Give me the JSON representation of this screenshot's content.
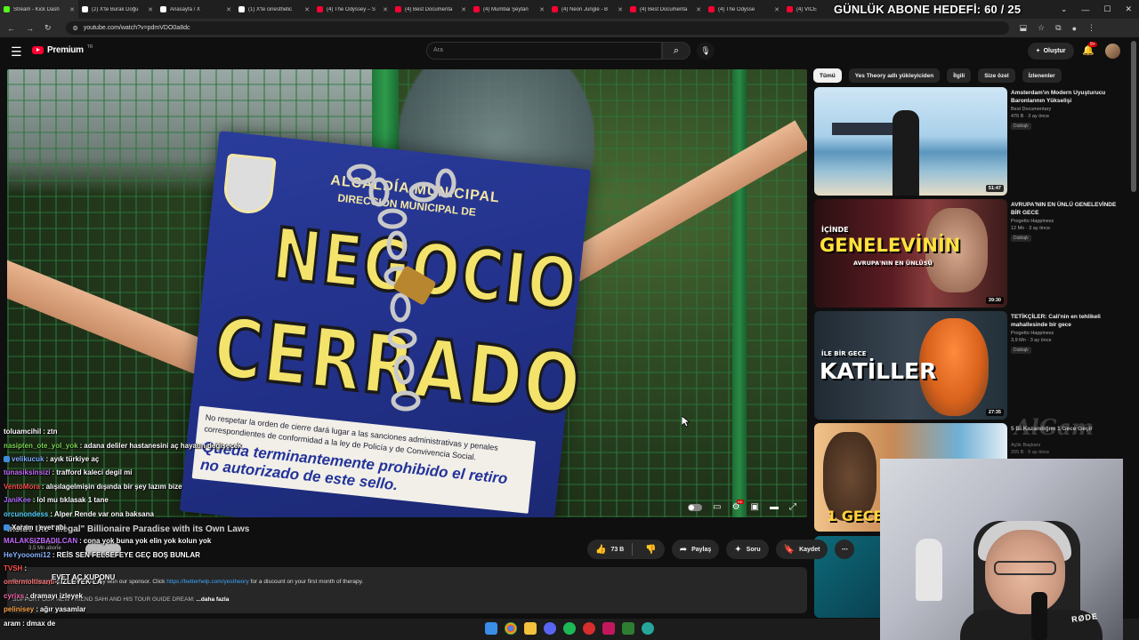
{
  "browser": {
    "tabs": [
      {
        "label": "Stream - Kick Dash",
        "color": "#53fc18"
      },
      {
        "label": "(2) X'te Burak Doğu",
        "color": "#ffffff"
      },
      {
        "label": "Anasayfa / X",
        "color": "#ffffff"
      },
      {
        "label": "(1) X'te cinesthetic",
        "color": "#ffffff"
      },
      {
        "label": "(4) The Odyssey – S",
        "color": "#ff0033"
      },
      {
        "label": "(4) Best Documenta",
        "color": "#ff0033"
      },
      {
        "label": "(4) Mumbai Şeytan",
        "color": "#ff0033"
      },
      {
        "label": "(4) Neon Jungle - B",
        "color": "#ff0033"
      },
      {
        "label": "(4) Best Documenta",
        "color": "#ff0033"
      },
      {
        "label": "(4) The Odysse",
        "color": "#ff0033"
      },
      {
        "label": "(4) VICE",
        "color": "#ff0033"
      }
    ],
    "url": "youtube.com/watch?v=pdmVDO0a8dc",
    "overlay_goal": "GÜNLÜK ABONE HEDEFİ: 60 / 25"
  },
  "youtube": {
    "brand": "Premium",
    "brand_suffix": "TR",
    "search_placeholder": "Ara",
    "create_label": "Oluştur",
    "notification_count": "9+",
    "video": {
      "title": "Inside the \"Illegal\" Billionaire Paradise with its Own Laws",
      "channel": "Yes Theory",
      "subscribers": "3,5 Mn abone",
      "likes": "73 B",
      "share_label": "Paylaş",
      "ask_label": "Soru",
      "save_label": "Kaydet",
      "description_line1_a": "If you're struggling, consider therapy with our sponsor. Click ",
      "description_link": "https://betterhelp.com/yestheory",
      "description_line1_b": " for a discount on your first month of therapy.",
      "description_line2": "SUPPORT OUR NEW FRIEND SAHI AND HIS TOUR GUIDE DREAM: ",
      "more_label": "...daha fazla"
    },
    "chips": [
      "Tümü",
      "Yes Theory adlı yükleyiciden",
      "İlgili",
      "Size özel",
      "İzlenenler"
    ],
    "recommendations": [
      {
        "title": "Amsterdam'ın Modern Uyuşturucu Baronlarının Yükselişi",
        "channel": "Best Documentary",
        "meta": "476 B · 3 ay önce",
        "badge": "Dublajlı",
        "duration": "51:47"
      },
      {
        "title": "AVRUPA'NIN EN ÜNLÜ GENELEVİNDE BİR GECE",
        "channel": "Progetto Happiness",
        "meta": "12 Mn · 3 ay önce",
        "badge": "Dublajlı",
        "duration": "39:30",
        "thumb_big": "GENELEVİNİN",
        "thumb_top": "İÇİNDE",
        "thumb_sub": "AVRUPA'NIN EN ÜNLÜSÜ"
      },
      {
        "title": "TETİKÇİLER: Cali'nin en tehlikeli mahallesinde bir gece",
        "channel": "Progetto Happiness",
        "meta": "3,9 Mn · 3 ay önce",
        "badge": "Dublajlı",
        "duration": "27:35",
        "thumb_big": "KATİLLER",
        "thumb_top": "İLE BİR GECE"
      },
      {
        "title": "5 Bİ Kazandığım 1 Gece Geçir",
        "channel": "Açlık Başkanı",
        "meta": "205 B · 5 ay önce",
        "thumb_big": "1 GECE"
      }
    ]
  },
  "chat": [
    {
      "user": "toluamcihil",
      "color": "#ffffff",
      "text": "ztn"
    },
    {
      "user": "nasipten_ote_yol_yok",
      "color": "#7ed957",
      "text": "adana deliler hastanesini aç hayatın değişecek"
    },
    {
      "user": "velikucuk",
      "color": "#7fb3ff",
      "text": "ayık türkiye aç",
      "badge": true
    },
    {
      "user": "tunasiksinsizi",
      "color": "#c66bff",
      "text": "trafford kaleci degil mi"
    },
    {
      "user": "VentoMora",
      "color": "#ff5050",
      "text": "alışılagelmişin dışında bir şey lazım bize"
    },
    {
      "user": "JaniKee",
      "color": "#b36bff",
      "text": "lol mu tıklasak 1 tane"
    },
    {
      "user": "orcunondess",
      "color": "#5ad1ff",
      "text": "Alper Rende var ona baksana"
    },
    {
      "user": "Xaram",
      "color": "#ffffff",
      "text": "evet abi",
      "badge": true
    },
    {
      "user": "MALAKSIZBADILCAN",
      "color": "#c66bff",
      "text": "cona yok buna yok elin yok kolun yok"
    },
    {
      "user": "HeYyooomi12",
      "color": "#8ab4ff",
      "text": "REİS SEN FELSEFEYE GEÇ BOŞ BUNLAR"
    },
    {
      "user": "TVSH",
      "color": "#ff5050",
      "text": ""
    },
    {
      "user": "omermoltisanti",
      "color": "#ff7b7b",
      "text": "İZLEYEK LA"
    },
    {
      "user": "cyrixs",
      "color": "#ff6bb5",
      "text": "dramayı izleyek"
    },
    {
      "user": "pelinisey",
      "color": "#ffa64d",
      "text": "ağır yasamlar"
    },
    {
      "user": "aram",
      "color": "#ffffff",
      "text": "dmax de"
    }
  ],
  "chat_coupon": "EVET AÇ KUPONU",
  "webcam_mic_brand": "RØDE",
  "watermark": "AlGam"
}
